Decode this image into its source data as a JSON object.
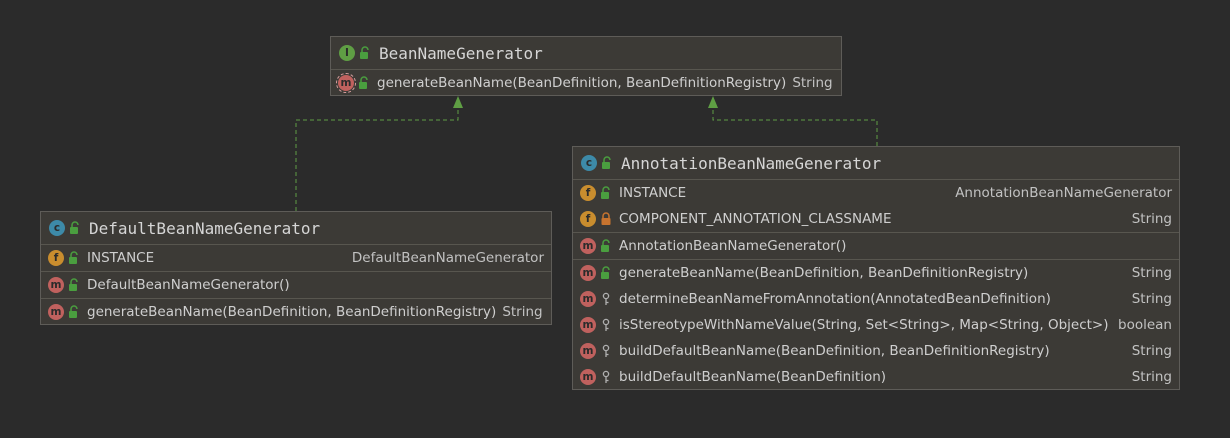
{
  "colors": {
    "background": "#2b2b2b",
    "box_fill": "#3c3a36",
    "edge": "#5f9e44",
    "interface_badge": "#5f9e44",
    "class_badge": "#3d8aa8",
    "field_badge": "#c98d2e",
    "method_badge": "#c0615e",
    "public_lock": "#4a9e3f",
    "private_lock": "#c8742f"
  },
  "icons": {
    "interface": "interface-i-icon",
    "class": "class-c-icon",
    "field": "field-f-icon",
    "method": "method-m-icon",
    "public": "open-lock-icon",
    "private": "closed-lock-icon",
    "package_private": "key-icon"
  },
  "badges": {
    "interface": "I",
    "class": "c",
    "field": "f",
    "method": "m"
  },
  "diagram": {
    "bean_name_generator": {
      "title": "BeanNameGenerator",
      "methods": [
        {
          "name": "generateBeanName(BeanDefinition, BeanDefinitionRegistry)",
          "type": "String"
        }
      ]
    },
    "default_bean_name_generator": {
      "title": "DefaultBeanNameGenerator",
      "fields": [
        {
          "name": "INSTANCE",
          "type": "DefaultBeanNameGenerator"
        }
      ],
      "constructors": [
        {
          "name": "DefaultBeanNameGenerator()"
        }
      ],
      "methods": [
        {
          "name": "generateBeanName(BeanDefinition, BeanDefinitionRegistry)",
          "type": "String"
        }
      ]
    },
    "annotation_bean_name_generator": {
      "title": "AnnotationBeanNameGenerator",
      "fields": [
        {
          "name": "INSTANCE",
          "type": "AnnotationBeanNameGenerator"
        },
        {
          "name": "COMPONENT_ANNOTATION_CLASSNAME",
          "type": "String"
        }
      ],
      "constructors": [
        {
          "name": "AnnotationBeanNameGenerator()"
        }
      ],
      "methods": [
        {
          "name": "generateBeanName(BeanDefinition, BeanDefinitionRegistry)",
          "type": "String"
        },
        {
          "name": "determineBeanNameFromAnnotation(AnnotatedBeanDefinition)",
          "type": "String"
        },
        {
          "name": "isStereotypeWithNameValue(String, Set<String>, Map<String, Object>)",
          "type": "boolean"
        },
        {
          "name": "buildDefaultBeanName(BeanDefinition, BeanDefinitionRegistry)",
          "type": "String"
        },
        {
          "name": "buildDefaultBeanName(BeanDefinition)",
          "type": "String"
        }
      ]
    }
  }
}
